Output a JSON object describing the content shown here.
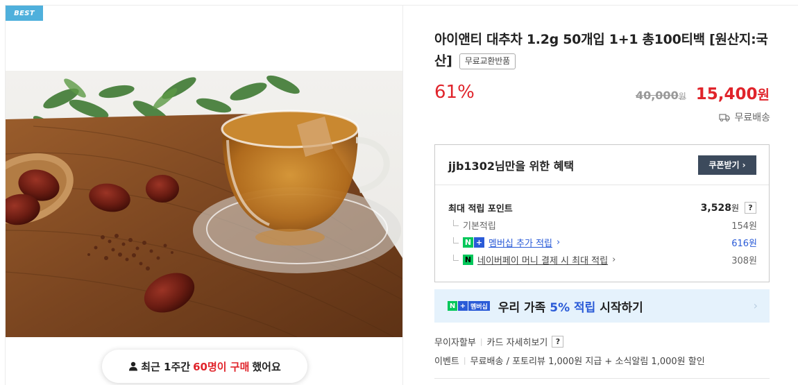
{
  "product": {
    "badge": "BEST",
    "title": "아이앤티 대추차 1.2g 50개입 1+1 총100티백 [원산지:국산]",
    "exchange_tag": "무료교환반품",
    "discount": "61%",
    "original_price": "40,000",
    "original_price_unit": "원",
    "sale_price": "15,400",
    "sale_price_unit": "원",
    "shipping": "무료배송"
  },
  "purchase_notice": {
    "prefix": "최근 1주간",
    "highlight": "60명이 구매",
    "suffix": "했어요"
  },
  "benefits": {
    "title": "jjb1302님만을 위한 혜택",
    "coupon_button": "쿠폰받기",
    "max_points_label": "최대 적립 포인트",
    "max_points_value": "3,528",
    "max_points_unit": "원",
    "help": "?",
    "rows": [
      {
        "label": "기본적립",
        "value": "154원"
      },
      {
        "label": "멤버십 추가 적립",
        "value": "616원"
      },
      {
        "label": "네이버페이 머니 결제 시 최대 적립",
        "value": "308원"
      }
    ]
  },
  "membership_banner": {
    "badge_n": "N",
    "badge_plus": "+",
    "badge_label": "멤버십",
    "text_prefix": "우리 가족",
    "text_highlight": "5% 적립",
    "text_suffix": "시작하기"
  },
  "info": {
    "installment": "무이자할부",
    "card_details": "카드 자세히보기",
    "help": "?",
    "event_label": "이벤트",
    "event_text": "무료배송 / 포토리뷰 1,000원 지급 + 소식알림 1,000원 할인"
  },
  "colors": {
    "accent_red": "#e0242b",
    "naver_green": "#03c75a",
    "naver_blue": "#2a5bd7",
    "best_badge": "#4fb0dc"
  }
}
